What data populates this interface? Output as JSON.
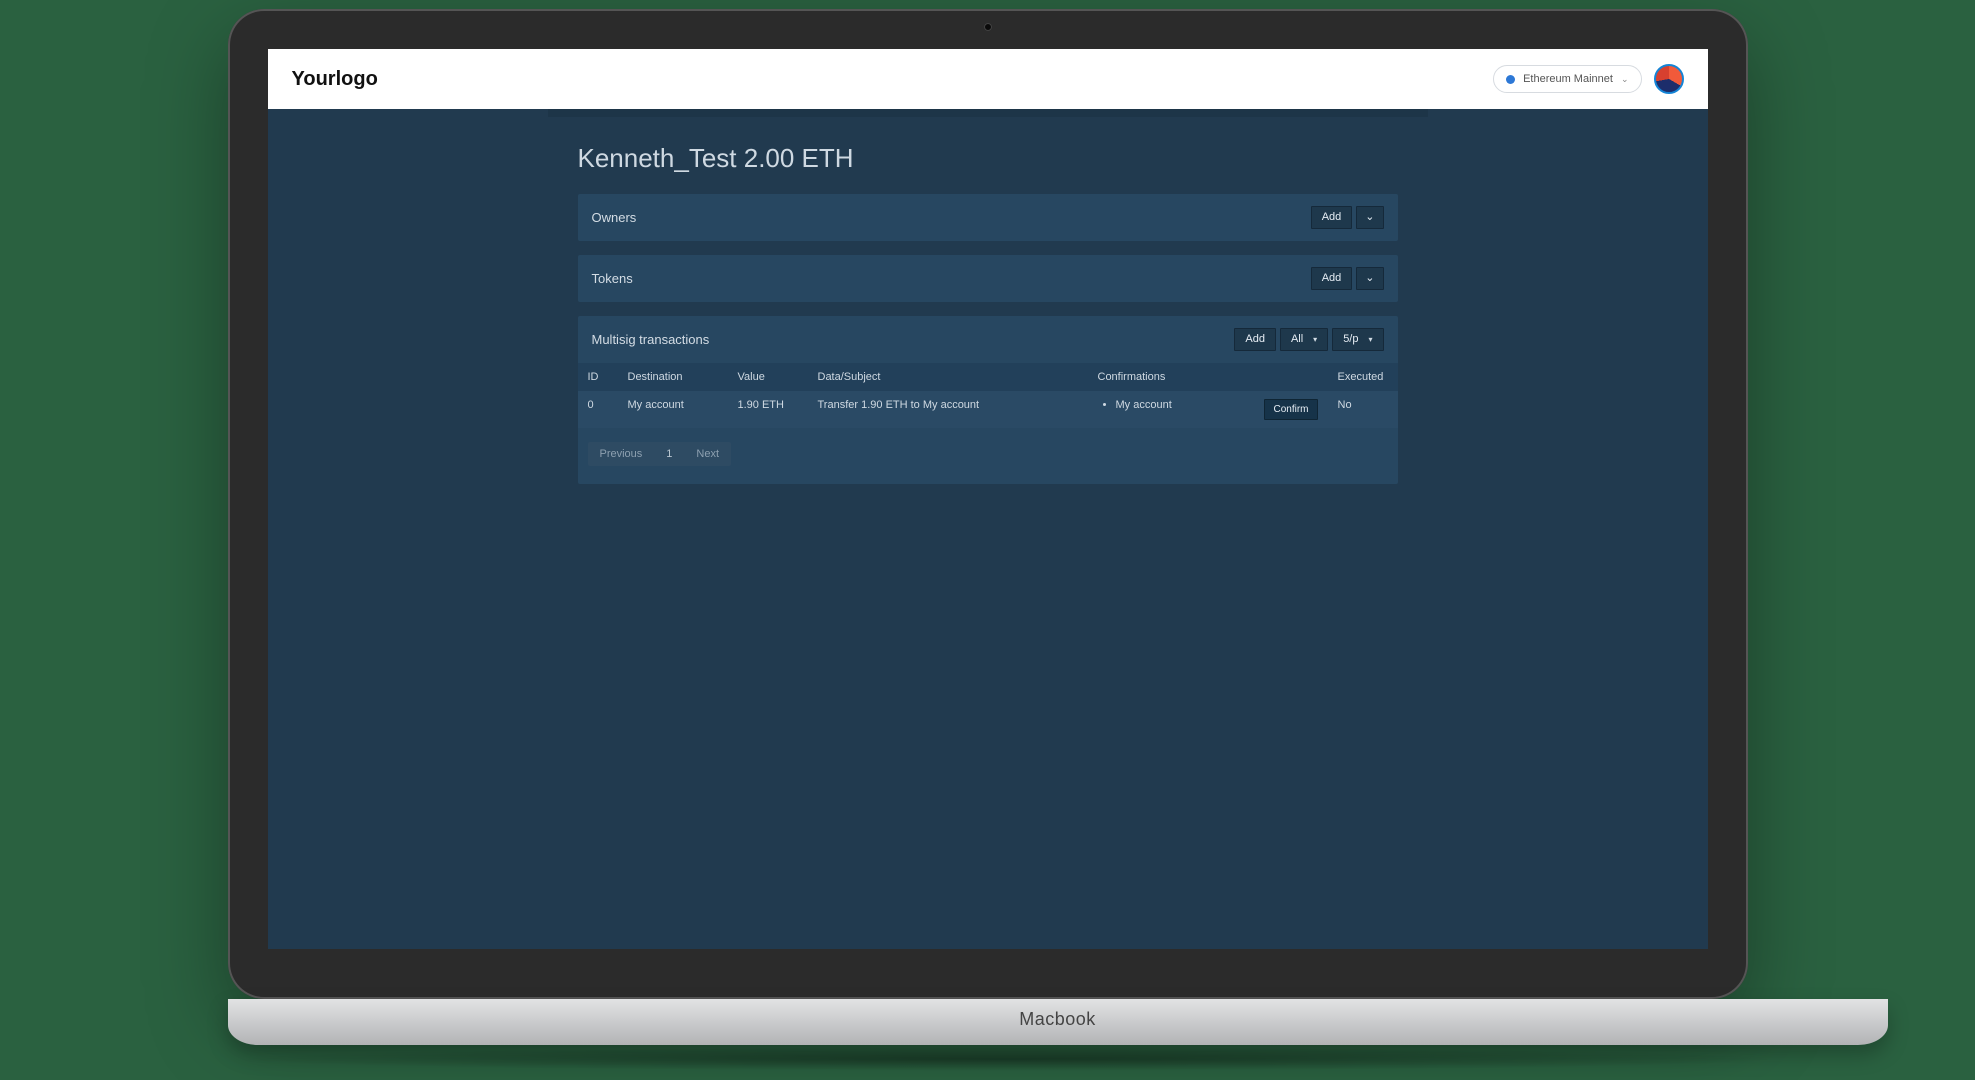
{
  "device_label": "Macbook",
  "header": {
    "logo": "Yourlogo",
    "network": {
      "label": "Ethereum Mainnet"
    }
  },
  "page": {
    "title": "Kenneth_Test 2.00 ETH"
  },
  "panels": {
    "owners": {
      "title": "Owners",
      "add_label": "Add"
    },
    "tokens": {
      "title": "Tokens",
      "add_label": "Add"
    },
    "multisig": {
      "title": "Multisig transactions",
      "add_label": "Add",
      "filter_selected": "All",
      "pagesize_selected": "5/p",
      "columns": {
        "id": "ID",
        "destination": "Destination",
        "value": "Value",
        "data_subject": "Data/Subject",
        "confirmations": "Confirmations",
        "executed": "Executed"
      },
      "rows": [
        {
          "id": "0",
          "destination": "My account",
          "value": "1.90 ETH",
          "data_subject": "Transfer 1.90 ETH to My account",
          "confirmations": [
            "My account"
          ],
          "confirm_label": "Confirm",
          "executed": "No"
        }
      ],
      "pager": {
        "prev": "Previous",
        "pages": [
          "1"
        ],
        "next": "Next"
      }
    }
  }
}
